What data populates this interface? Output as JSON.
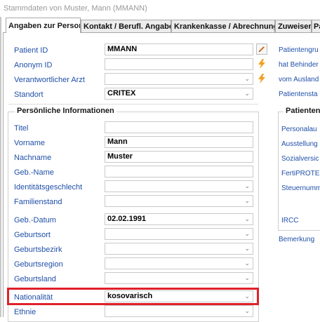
{
  "window": {
    "title": "Stammdaten von Muster, Mann (MMANN)"
  },
  "tabs": [
    "Angaben zur Person",
    "Kontakt / Berufl. Angaben",
    "Krankenkasse / Abrechnung",
    "Zuweiser",
    "Pa"
  ],
  "form": {
    "patient_id": {
      "label": "Patient ID",
      "value": "MMANN"
    },
    "anonym_id": {
      "label": "Anonym ID",
      "value": ""
    },
    "arzt": {
      "label": "Verantwortlicher Arzt",
      "value": ""
    },
    "standort": {
      "label": "Standort",
      "value": "CRITEX"
    }
  },
  "personal": {
    "group_title": "Persönliche Informationen",
    "titel": {
      "label": "Titel",
      "value": ""
    },
    "vorname": {
      "label": "Vorname",
      "value": "Mann"
    },
    "nachname": {
      "label": "Nachname",
      "value": "Muster"
    },
    "geb_name": {
      "label": "Geb.-Name",
      "value": ""
    },
    "identitaet": {
      "label": "Identitätsgeschlecht",
      "value": ""
    },
    "familienstand": {
      "label": "Familienstand",
      "value": ""
    },
    "geb_datum": {
      "label": "Geb.-Datum",
      "value": "02.02.1991"
    },
    "geburtsort": {
      "label": "Geburtsort",
      "value": ""
    },
    "geburtsbezirk": {
      "label": "Geburtsbezirk",
      "value": ""
    },
    "geburtsregion": {
      "label": "Geburtsregion",
      "value": ""
    },
    "geburtsland": {
      "label": "Geburtsland",
      "value": ""
    },
    "nationalitaet": {
      "label": "Nationalität",
      "value": "kosovarisch"
    },
    "ethnie": {
      "label": "Ethnie",
      "value": ""
    }
  },
  "right": {
    "patientengruppe": "Patientengru",
    "behinderung": "hat Behinder",
    "ausland": "vom Ausland",
    "patientenstatus": "Patientensta",
    "group_title": "Patientenic",
    "personalausweis": "Personalau",
    "ausstellung": "Ausstellung",
    "sozialversicherung": "Sozialversic",
    "ferti": "FertiPROTE",
    "steuernummer": "Steuernumm",
    "ircc": "IRCC",
    "bemerkung": "Bemerkung"
  },
  "colors": {
    "label_blue": "#1f4fa8",
    "highlight_red": "#e0202a",
    "lightning": "#f0a020",
    "pencil": "#d86a1a"
  },
  "icons": [
    "pencil-icon",
    "lightning-icon",
    "chevron-down-icon"
  ]
}
